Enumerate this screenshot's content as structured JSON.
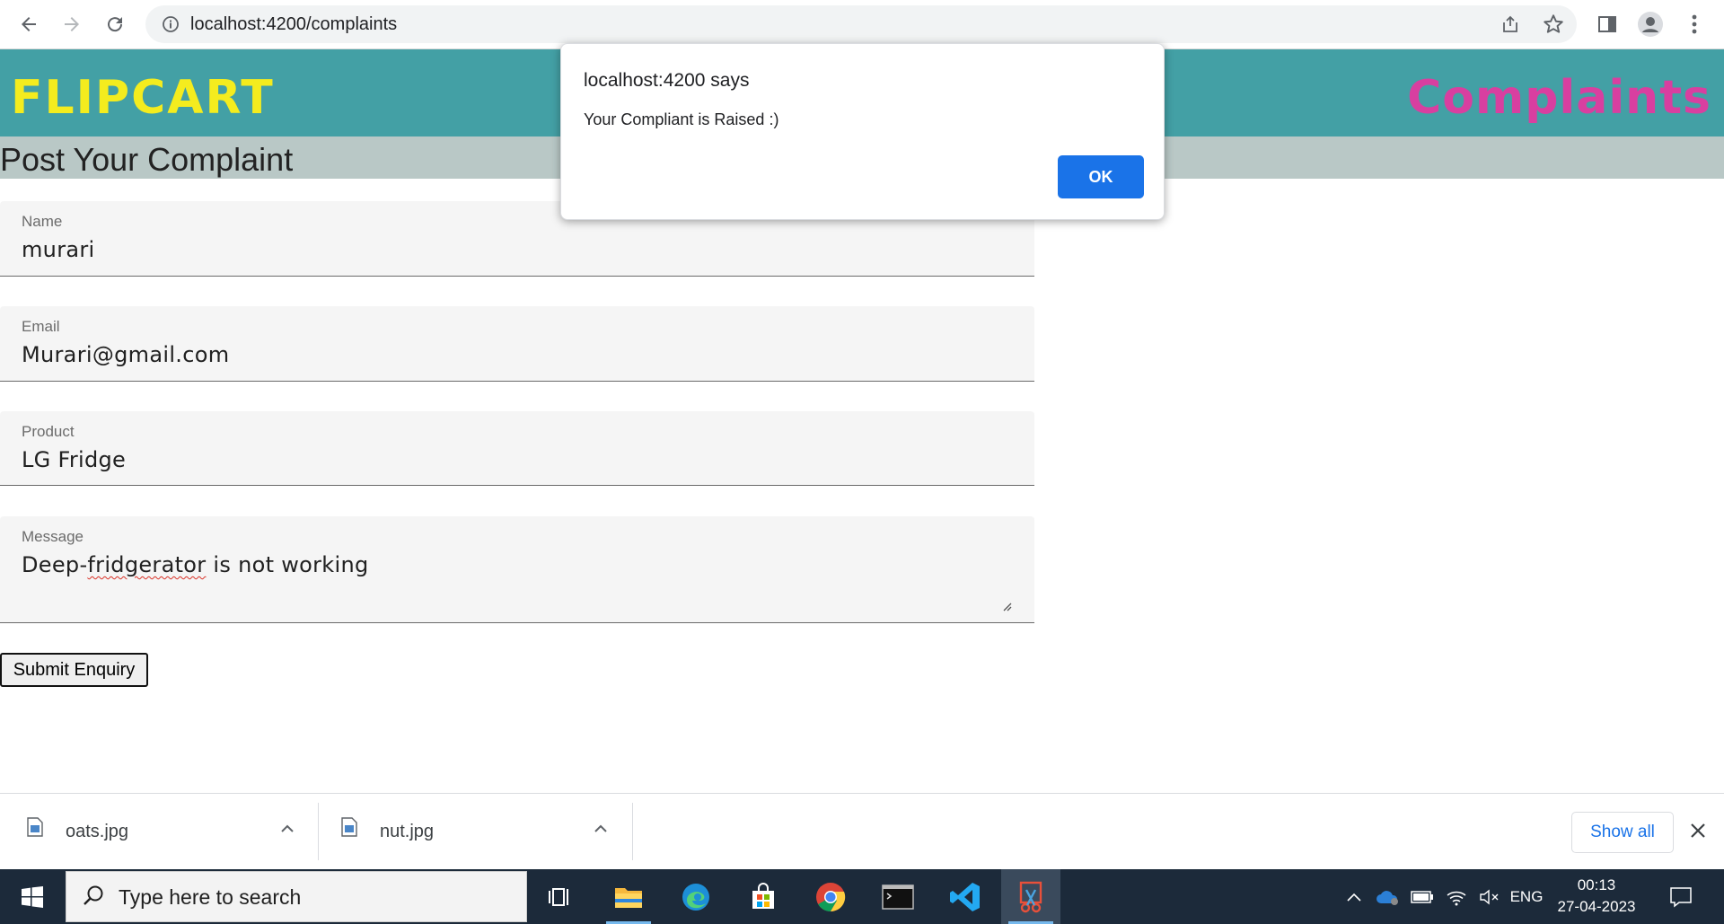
{
  "browser": {
    "url": "localhost:4200/complaints"
  },
  "header": {
    "brand": "FLIPCART",
    "page_name": "Complaints",
    "brand_color": "#f4ec1e",
    "page_name_color": "#d83fa0",
    "background": "#43a0a5"
  },
  "subheader": {
    "title": "Post Your Complaint"
  },
  "form": {
    "name": {
      "label": "Name",
      "value": "murari"
    },
    "email": {
      "label": "Email",
      "value": "Murari@gmail.com"
    },
    "product": {
      "label": "Product",
      "value": "LG Fridge"
    },
    "message": {
      "label": "Message",
      "value_prefix": "Deep-",
      "value_misspelled": "fridgerator",
      "value_suffix": " is not working"
    },
    "submit_label": "Submit Enquiry"
  },
  "dialog": {
    "title": "localhost:4200 says",
    "message": "Your Compliant is Raised :)",
    "ok_label": "OK",
    "ok_color": "#1a73e8"
  },
  "downloads": {
    "items": [
      {
        "name": "oats.jpg"
      },
      {
        "name": "nut.jpg"
      }
    ],
    "show_all_label": "Show all"
  },
  "taskbar": {
    "search_placeholder": "Type here to search",
    "language": "ENG",
    "time": "00:13",
    "date": "27-04-2023",
    "apps": [
      "task-view-icon",
      "file-explorer-icon",
      "edge-icon",
      "store-icon",
      "chrome-icon",
      "terminal-icon",
      "vscode-icon",
      "snipping-tool-icon"
    ]
  }
}
